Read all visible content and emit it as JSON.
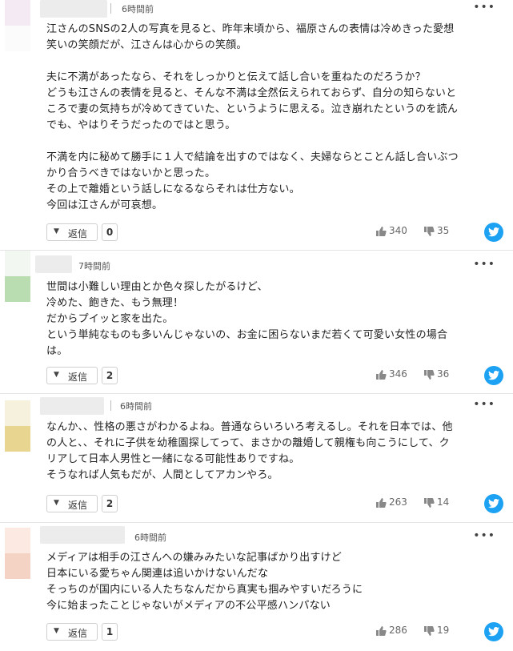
{
  "labels": {
    "reply": "返信",
    "more": "•••"
  },
  "colors": {
    "twitter": "#1da1f2",
    "border": "#cfcfcf",
    "text": "#222222"
  },
  "comments": [
    {
      "timestamp": "6時間前",
      "body": "江さんのSNSの2人の写真を見ると、昨年末頃から、福原さんの表情は冷めきった愛想\n笑いの笑顔だが、江さんは心からの笑顔。\n\n夫に不満があったなら、それをしっかりと伝えて話し合いを重ねたのだろうか？\nどうも江さんの表情を見ると、そんな不満は全然伝えられておらず、自分の知らないと\nころで妻の気持ちが冷めてきていた、というように思える。泣き崩れたというのを読ん\nでも、やはりそうだったのではと思う。\n\n不満を内に秘めて勝手に１人で結論を出すのではなく、夫婦ならとことん話し合いぶつ\nかり合うべきではないかと思った。\nその上で離婚という話しになるならそれは仕方ない。\n今回は江さんが可哀想。",
      "reply_count": "0",
      "likes": "340",
      "dislikes": "35"
    },
    {
      "timestamp": "7時間前",
      "body": "世間は小難しい理由とか色々探したがるけど、\n冷めた、飽きた、もう無理！\nだからプイッと家を出た。\nという単純なものも多いんじゃないの、お金に困らないまだ若くて可愛い女性の場合\nは。",
      "reply_count": "2",
      "likes": "346",
      "dislikes": "36"
    },
    {
      "timestamp": "6時間前",
      "body": "なんか、、性格の悪さがわかるよね。普通ならいろいろ考えるし。それを日本では、他\nの人と、、それに子供を幼稚園探してって、まさかの離婚して親権も向こうにして、ク\nリアして日本人男性と一緒になる可能性ありですね。\nそうなれば人気もだが、人間としてアカンやろ。",
      "reply_count": "2",
      "likes": "263",
      "dislikes": "14"
    },
    {
      "timestamp": "6時間前",
      "body": "メディアは相手の江さんへの嫌みみたいな記事ばかり出すけど\n日本にいる愛ちゃん関連は追いかけないんだな\nそっちのが国内にいる人たちなんだから真実も掴みやすいだろうに\n今に始まったことじゃないがメディアの不公平感ハンパない",
      "reply_count": "1",
      "likes": "286",
      "dislikes": "19"
    }
  ]
}
